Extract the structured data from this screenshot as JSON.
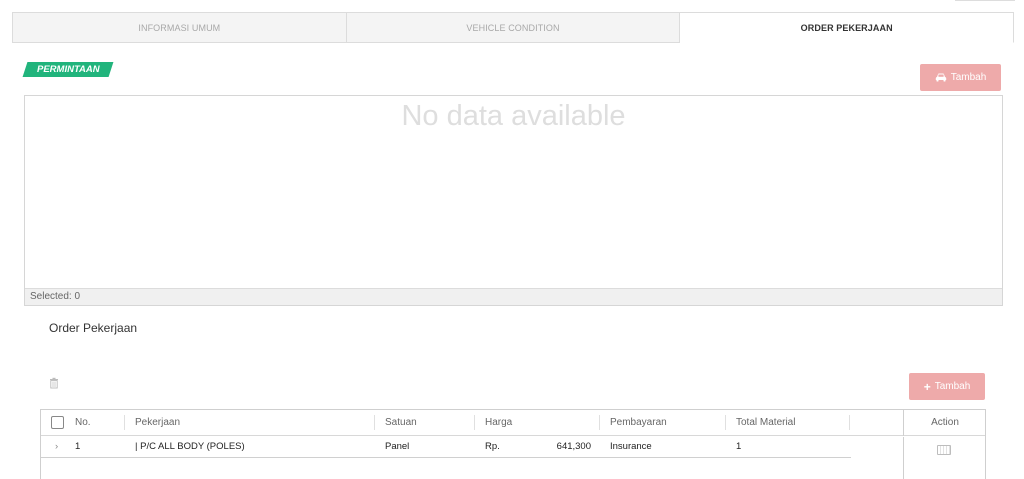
{
  "tabs": [
    {
      "label": "INFORMASI UMUM",
      "active": false
    },
    {
      "label": "VEHICLE CONDITION",
      "active": false
    },
    {
      "label": "ORDER PEKERJAAN",
      "active": true
    }
  ],
  "permintaan": {
    "badge": "PERMINTAAN",
    "add_button": "Tambah",
    "add_icon": "car-icon",
    "empty_text": "No data available",
    "footer": "Selected: 0"
  },
  "order": {
    "title": "Order Pekerjaan",
    "delete_icon": "trash-icon",
    "add_button": "Tambah",
    "add_icon": "plus-icon",
    "columns": [
      "No.",
      "Pekerjaan",
      "Satuan",
      "Harga",
      "Pembayaran",
      "Total Material",
      "Action"
    ],
    "rows": [
      {
        "no": "1",
        "pekerjaan": "| P/C ALL BODY (POLES)",
        "satuan": "Panel",
        "harga_currency": "Rp.",
        "harga_value": "641,300",
        "pembayaran": "Insurance",
        "total_material": "1",
        "action_icon": "keyboard-icon"
      }
    ]
  },
  "colors": {
    "accent": "#21b47c",
    "button_disabled": "#eeaaaa"
  }
}
